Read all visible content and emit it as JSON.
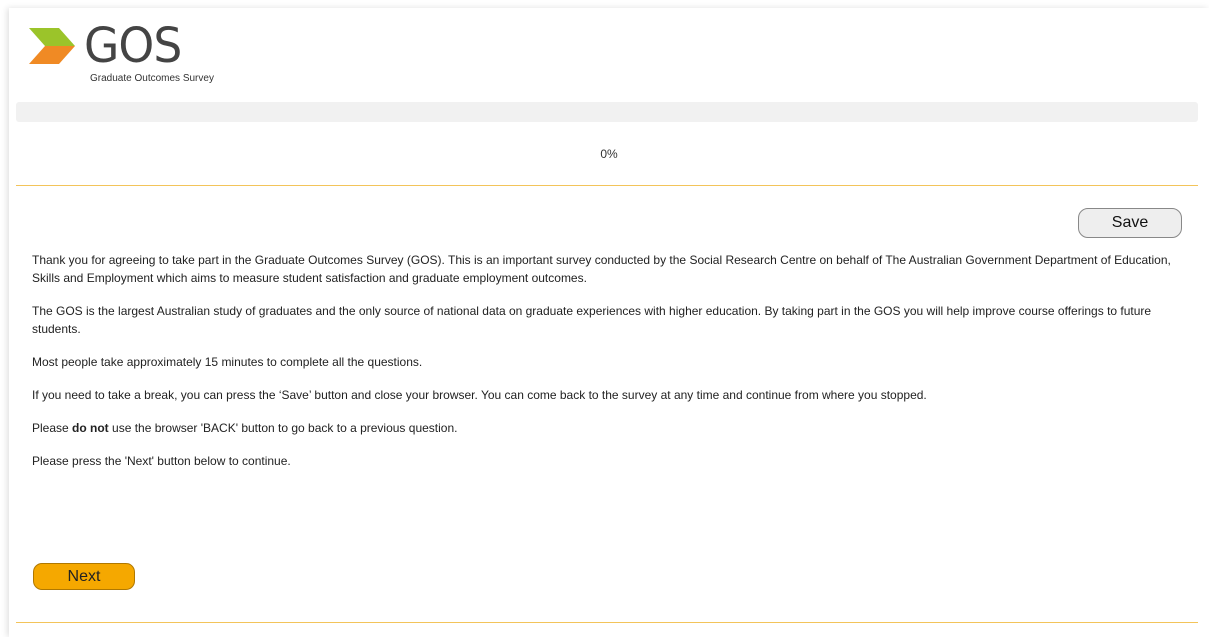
{
  "brand": {
    "logo_text": "GOS",
    "logo_subtitle": "Graduate Outcomes Survey",
    "colors": {
      "green": "#9bc42a",
      "orange": "#f08a24",
      "accent": "#f5a800"
    }
  },
  "progress": {
    "label": "0%",
    "fraction": 0
  },
  "actions": {
    "save_label": "Save",
    "next_label": "Next"
  },
  "content": {
    "p1": "Thank you for agreeing to take part in the Graduate Outcomes Survey (GOS). This is an important survey conducted by the Social Research Centre on behalf of The Australian Government Department of Education, Skills and Employment which aims to measure student satisfaction and graduate employment outcomes.",
    "p2": "The GOS is the largest Australian study of graduates and the only source of national data on graduate experiences with higher education. By taking part in the GOS you will help improve course offerings to future students.",
    "p3": "Most people take approximately 15 minutes to complete all the questions.",
    "p4": "If you need to take a break, you can press the ‘Save’ button and close your browser. You can come back to the survey at any time and continue from where you stopped.",
    "p5_before": "Please ",
    "p5_bold": "do not",
    "p5_after": " use the browser 'BACK' button to go back to a previous question.",
    "p6": "Please press the 'Next' button below to continue."
  }
}
